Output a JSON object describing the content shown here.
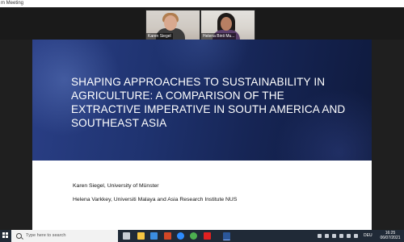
{
  "window": {
    "title": "m Meeting"
  },
  "participants": [
    {
      "name": "Karen Siegel"
    },
    {
      "name": "Helena Binti Mu..."
    }
  ],
  "slide": {
    "title": "SHAPING APPROACHES TO SUSTAINABILITY IN AGRICULTURE: A COMPARISON OF THE EXTRACTIVE IMPERATIVE IN SOUTH AMERICA AND SOUTHEAST ASIA",
    "authors": [
      "Karen Siegel, University of Münster",
      "Helena Varkkey, Universiti Malaya and Asia Research Institute NUS"
    ],
    "header_color": "#1f3370"
  },
  "taskbar": {
    "search_placeholder": "Type here to search",
    "pinned_icons": [
      {
        "name": "task-view-icon",
        "color": "#c9ced6"
      },
      {
        "name": "file-explorer-icon",
        "color": "#f5c542"
      },
      {
        "name": "store-icon",
        "color": "#3b8de0"
      },
      {
        "name": "powerpoint-icon",
        "color": "#d24726"
      },
      {
        "name": "zoom-icon",
        "color": "#2d8cff"
      },
      {
        "name": "chrome-icon",
        "color": "#4caf50"
      },
      {
        "name": "acrobat-icon",
        "color": "#e02020"
      },
      {
        "name": "word-icon",
        "color": "#2b579a"
      }
    ],
    "language": "DEU",
    "time": "16:25",
    "date": "06/07/2021"
  }
}
